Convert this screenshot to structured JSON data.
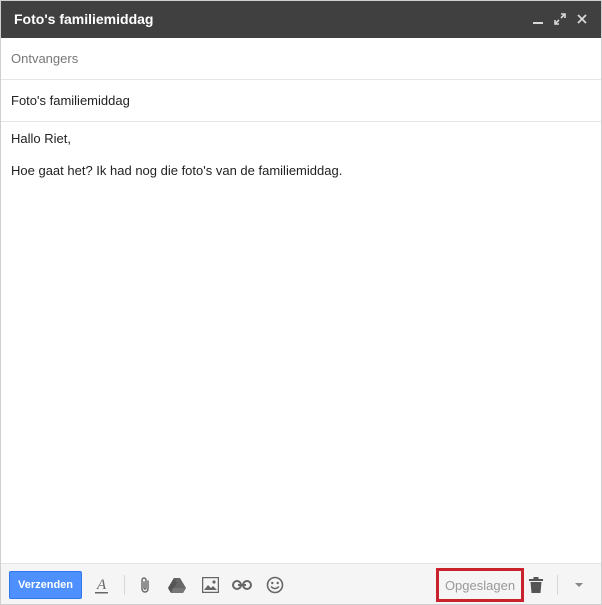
{
  "window": {
    "title": "Foto's familiemiddag"
  },
  "recipients": {
    "placeholder": "Ontvangers",
    "value": ""
  },
  "subject": {
    "value": "Foto's familiemiddag"
  },
  "message": {
    "lines": [
      "Hallo Riet,",
      "Hoe gaat het? Ik had nog die foto's van de familiemiddag."
    ]
  },
  "toolbar": {
    "send_label": "Verzenden",
    "status_label": "Opgeslagen"
  },
  "icons": {
    "minimize": "minimize-icon",
    "popout": "popout-icon",
    "close": "close-icon",
    "format": "format-text-icon",
    "attach": "paperclip-icon",
    "drive": "drive-icon",
    "photo": "photo-icon",
    "link": "link-icon",
    "emoji": "smiley-icon",
    "trash": "trash-icon",
    "more": "chevron-down-icon"
  },
  "colors": {
    "titlebar": "#404040",
    "send_button": "#4d90fe",
    "highlight": "#c8232c"
  }
}
